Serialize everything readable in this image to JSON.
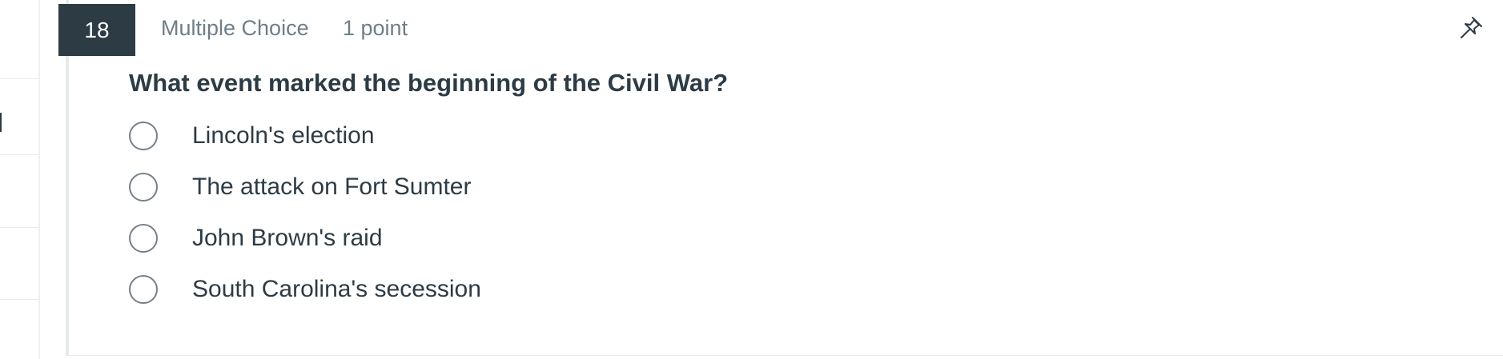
{
  "question": {
    "number": "18",
    "type": "Multiple Choice",
    "points": "1 point",
    "text": "What event marked the beginning of the Civil War?",
    "pin_icon": "pin-icon",
    "answers": [
      {
        "label": "Lincoln's election",
        "selected": false
      },
      {
        "label": "The attack on Fort Sumter",
        "selected": false
      },
      {
        "label": "John Brown's raid",
        "selected": false
      },
      {
        "label": "South Carolina's secession",
        "selected": false
      }
    ]
  },
  "colors": {
    "badge_background": "#2d3b45",
    "text_primary": "#2d3b45",
    "text_muted": "#6f7e88",
    "radio_border": "#73818b"
  }
}
